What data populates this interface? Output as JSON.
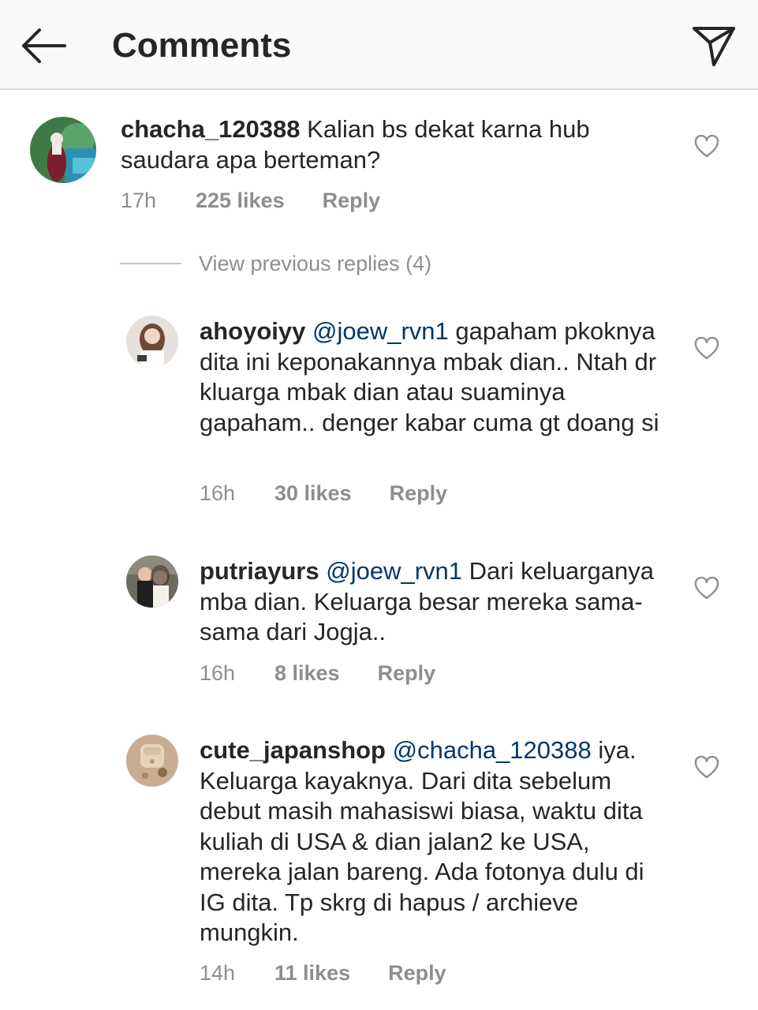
{
  "header": {
    "title": "Comments",
    "back_icon": "arrow-left-icon",
    "share_icon": "direct-send-icon"
  },
  "comment_main": {
    "username": "chacha_120388",
    "text": " Kalian bs dekat karna hub saudara apa berteman?",
    "time": "17h",
    "likes": "225 likes",
    "reply": "Reply"
  },
  "view_replies": {
    "label": "View previous replies (4)"
  },
  "replies": [
    {
      "username": "ahoyoiyy",
      "mention": "@joew_rvn1",
      "text": " gapaham pkoknya dita ini keponakannya mbak dian.. Ntah dr kluarga mbak dian atau suaminya gapaham.. denger kabar cuma gt doang si",
      "time": "16h",
      "likes": "30 likes",
      "reply": "Reply"
    },
    {
      "username": "putriayurs",
      "mention": "@joew_rvn1",
      "text": " Dari keluarganya mba dian. Keluarga besar mereka sama-sama dari Jogja..",
      "time": "16h",
      "likes": "8 likes",
      "reply": "Reply"
    },
    {
      "username": "cute_japanshop",
      "mention": "@chacha_120388",
      "text": " iya. Keluarga kayaknya. Dari dita sebelum debut masih mahasiswi biasa, waktu dita kuliah di USA & dian jalan2 ke USA, mereka jalan bareng. Ada fotonya dulu di IG dita. Tp skrg di hapus / archieve mungkin.",
      "time": "14h",
      "likes": "11 likes",
      "reply": "Reply"
    }
  ],
  "colors": {
    "header_bg": "#fafafa",
    "text": "#262626",
    "meta": "#8e8e8e",
    "mention": "#00376b",
    "divider": "#dbdbdb"
  }
}
